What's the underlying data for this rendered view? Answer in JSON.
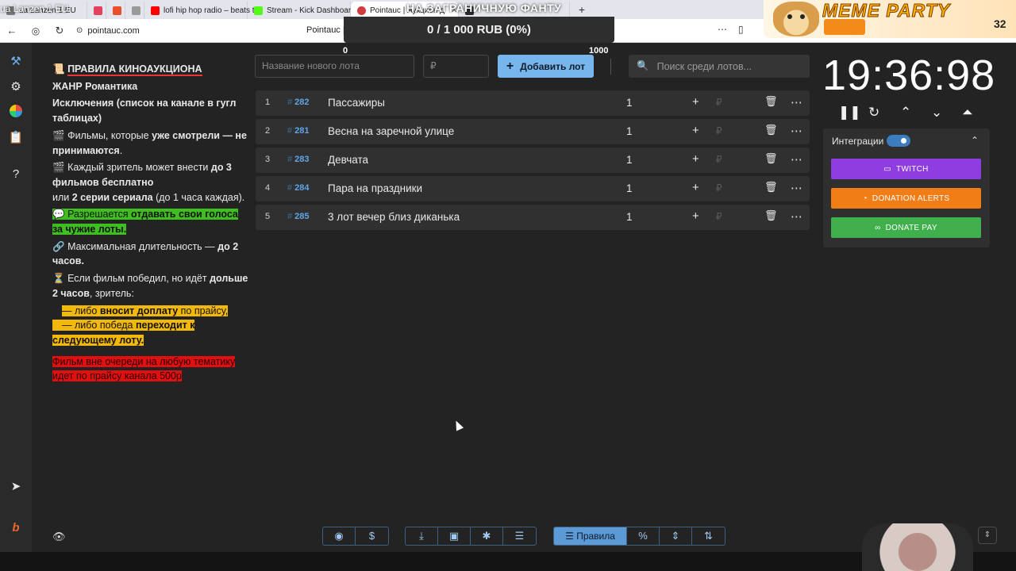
{
  "browser": {
    "tabs": [
      {
        "label": "ua Lanzen 1 EU",
        "color": "#7a7a7a"
      },
      {
        "label": "",
        "color": "#e4405f"
      },
      {
        "label": "",
        "color": "#e94f2a"
      },
      {
        "label": "",
        "color": "#9a9a9a"
      },
      {
        "label": "lofi hip hop radio – beats t",
        "color": "#ff0000"
      },
      {
        "label": "Stream - Kick Dashboard",
        "color": "#53fc18"
      },
      {
        "label": "Pointauc | Аукцион д",
        "color": "#d13b3b"
      },
      {
        "label": "НА ЗАГРАНИЧНУЮ ФАНТУ",
        "color": "#2b2b2b"
      }
    ],
    "url": "pointauc.com",
    "page_title": "Pointauc |"
  },
  "overlay": {
    "goal_text": "0 / 1 000 RUB (0%)",
    "goal_min": "0",
    "goal_max": "1000",
    "meme_title": "MEME PARTY",
    "meme_num": "32"
  },
  "rules": {
    "title": "ПРАВИЛА КИНОАУКЦИОНА",
    "genre": "ЖАНР Романтика",
    "exceptions": "Исключения (список на канале в гугл таблицах)",
    "r1_a": "Фильмы, которые ",
    "r1_b": "уже смотрели — не принимаются",
    "r1_c": ".",
    "r2_a": "Каждый зритель может внести ",
    "r2_b": "до 3 фильмов бесплатно",
    "r2_c": "или ",
    "r2_d": "2 серии сериала",
    "r2_e": " (до 1 часа каждая).",
    "r3_a": "Разрешается ",
    "r3_b": "отдавать свои голоса за чужие лоты.",
    "r4_a": "Максимальная длительность — ",
    "r4_b": "до 2 часов.",
    "r5_a": "Если фильм победил, но идёт ",
    "r5_b": "дольше 2 часов",
    "r5_c": ", зритель:",
    "r6_a": "— либо ",
    "r6_b": "вносит доплату",
    "r6_c": " по прайсу,",
    "r7_a": "— либо победа ",
    "r7_b": "переходит к следующему лоту.",
    "r8": "Фильм вне очереди на любую тематику идет по прайсу канала 500р"
  },
  "controls": {
    "new_lot_placeholder": "Название нового лота",
    "amount_placeholder": "₽",
    "add_lot_label": "Добавить лот",
    "search_placeholder": "Поиск среди лотов..."
  },
  "lots": [
    {
      "n": "1",
      "id": "282",
      "name": "Пассажиры",
      "amount": "1"
    },
    {
      "n": "2",
      "id": "281",
      "name": "Весна на заречной улице",
      "amount": "1"
    },
    {
      "n": "3",
      "id": "283",
      "name": "Девчата",
      "amount": "1"
    },
    {
      "n": "4",
      "id": "284",
      "name": "Пара на праздники",
      "amount": "1"
    },
    {
      "n": "5",
      "id": "285",
      "name": " 3 лот вечер близ диканька",
      "amount": "1"
    }
  ],
  "timer": {
    "value": "19:36:98"
  },
  "integrations": {
    "label": "Интеграции",
    "twitch": "TWITCH",
    "donation_alerts": "DONATION ALERTS",
    "donate_pay": "DONATE PAY",
    "colors": {
      "twitch": "#8e3ee0",
      "donation_alerts": "#f17d16",
      "donate_pay": "#3fb04c"
    }
  },
  "toolbar": {
    "rules_label": "Правила"
  }
}
